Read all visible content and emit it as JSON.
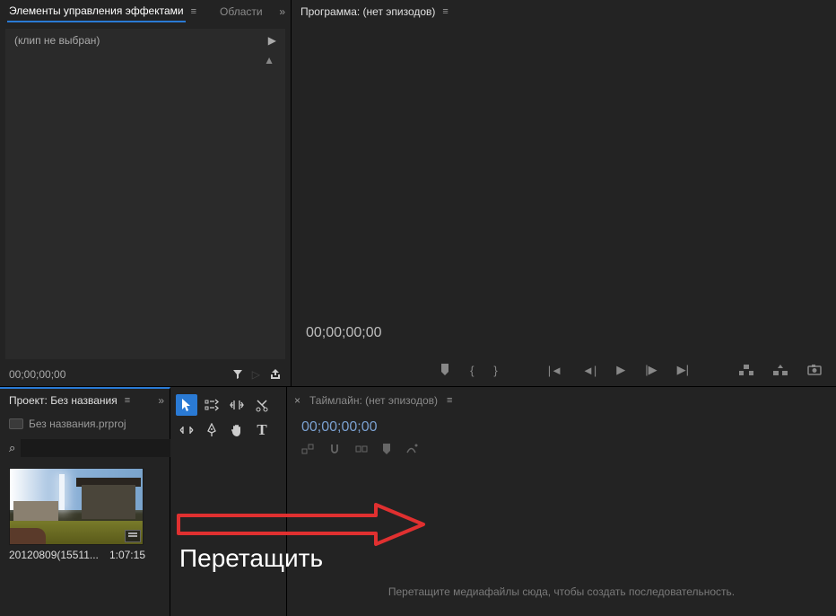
{
  "effects": {
    "tab_effects": "Элементы управления эффектами",
    "tab_regions": "Области",
    "clip_none": "(клип не выбран)",
    "timecode": "00;00;00;00"
  },
  "program": {
    "title": "Программа: (нет эпизодов)",
    "timecode": "00;00;00;00"
  },
  "project": {
    "tab": "Проект: Без названия",
    "file": "Без названия.prproj",
    "search_placeholder": "",
    "clip_name": "20120809(15511...",
    "clip_dur": "1:07:15"
  },
  "timeline": {
    "title": "Таймлайн: (нет эпизодов)",
    "timecode": "00;00;00;00",
    "dropzone": "Перетащите медиафайлы сюда, чтобы создать последовательность."
  },
  "annotation": {
    "text": "Перетащить"
  },
  "search_icon": "⌕"
}
